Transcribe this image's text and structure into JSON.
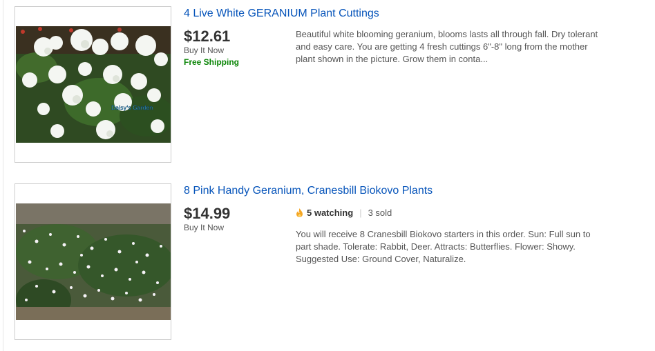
{
  "listings": [
    {
      "title": "4 Live White GERANIUM Plant Cuttings",
      "price": "$12.61",
      "format": "Buy It Now",
      "shipping": "Free Shipping",
      "description": "Beautiful white blooming geranium, blooms lasts all through fall. Dry tolerant and easy care. You are getting 4 fresh cuttings 6\"-8\" long from the mother plant shown in the picture. Grow them in conta...",
      "watermark": "Daisy's Garden"
    },
    {
      "title": "8 Pink Handy Geranium, Cranesbill Biokovo Plants",
      "price": "$14.99",
      "format": "Buy It Now",
      "watching": "5 watching",
      "separator": "|",
      "sold": "3 sold",
      "description": "You will receive 8 Cranesbill Biokovo starters in this order. Sun: Full sun to part shade. Tolerate: Rabbit, Deer. Attracts: Butterflies. Flower: Showy. Suggested Use: Ground Cover, Naturalize."
    }
  ],
  "colors": {
    "link": "#0654ba",
    "free_shipping": "#0a8506",
    "flame": "#f5a623"
  }
}
